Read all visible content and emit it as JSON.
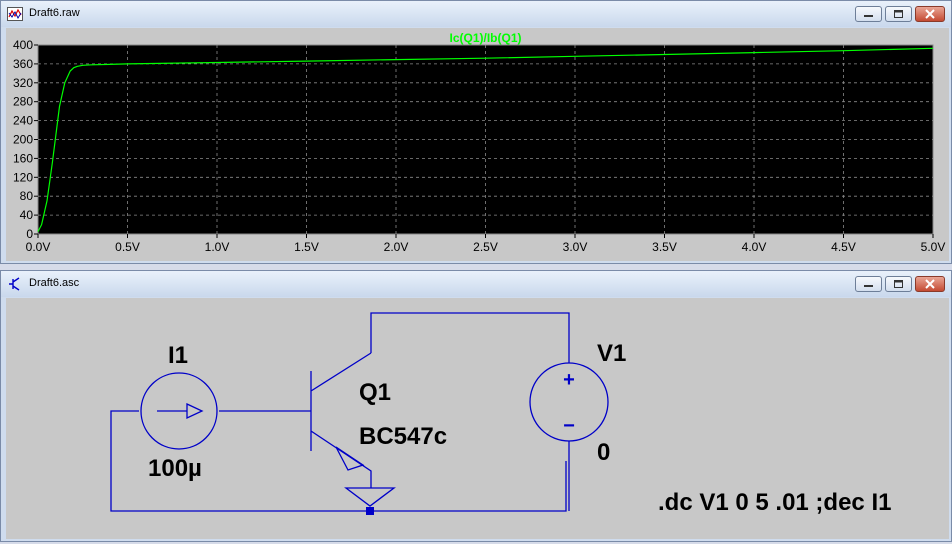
{
  "plot_window": {
    "title": "Draft6.raw",
    "icon": "waveform-icon"
  },
  "schematic_window": {
    "title": "Draft6.asc",
    "icon": "transistor-icon"
  },
  "window_buttons": [
    "minimize-icon",
    "maximize-icon",
    "close-icon"
  ],
  "colors": {
    "trace": "#00ff00",
    "plot_background": "#000000",
    "wire": "#0000c8",
    "title_bar": "#cfdcee",
    "close_button": "#c44a32"
  },
  "chart_data": {
    "type": "line",
    "title": "",
    "xlabel": "",
    "ylabel": "",
    "xlim": [
      0,
      5
    ],
    "ylim": [
      0,
      400
    ],
    "x_ticks": [
      "0.0V",
      "0.5V",
      "1.0V",
      "1.5V",
      "2.0V",
      "2.5V",
      "3.0V",
      "3.5V",
      "4.0V",
      "4.5V",
      "5.0V"
    ],
    "y_ticks": [
      "0",
      "40",
      "80",
      "120",
      "160",
      "200",
      "240",
      "280",
      "320",
      "360",
      "400"
    ],
    "grid": true,
    "series": [
      {
        "name": "Ic(Q1)/Ib(Q1)",
        "color": "#00ff00",
        "x": [
          0,
          0.02,
          0.05,
          0.08,
          0.1,
          0.12,
          0.15,
          0.18,
          0.2,
          0.22,
          0.25,
          0.3,
          0.4,
          0.5,
          1.0,
          1.5,
          2.0,
          2.5,
          3.0,
          3.5,
          4.0,
          4.5,
          5.0
        ],
        "y": [
          5,
          20,
          70,
          150,
          210,
          270,
          320,
          345,
          352,
          355,
          357,
          358,
          359,
          360,
          363,
          366,
          369,
          372,
          376,
          380,
          384,
          388,
          393
        ]
      }
    ]
  },
  "schematic": {
    "current_source": {
      "name": "I1",
      "value": "100µ"
    },
    "transistor": {
      "name": "Q1",
      "model": "BC547c"
    },
    "voltage_source": {
      "name": "V1",
      "value": "0",
      "plus": "+",
      "minus": "−"
    },
    "directive": ".dc V1 0 5 .01 ;dec I1"
  }
}
